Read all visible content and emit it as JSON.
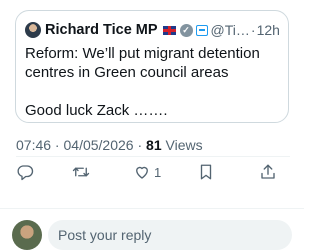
{
  "quote": {
    "author_name": "Richard Tice MP",
    "handle": "@Ti…",
    "separator": "·",
    "time": "12h",
    "text_line1": "Reform: We’ll put migrant detention centres in Green council areas",
    "text_line2": "Good luck Zack ……."
  },
  "meta": {
    "time": "07:46",
    "sep1": " · ",
    "date": "04/05/2026",
    "sep2": " · ",
    "views_count": "81",
    "views_label": " Views"
  },
  "actions": {
    "like_count": "1"
  },
  "reply": {
    "placeholder": "Post your reply"
  },
  "colors": {
    "text_primary": "#0f1419",
    "text_secondary": "#536471",
    "border": "#cfd9de",
    "accent": "#1d9bf0"
  },
  "icons": [
    "reply-icon",
    "retweet-icon",
    "heart-icon",
    "bookmark-icon",
    "share-icon",
    "verified-icon",
    "affiliate-icon",
    "flag-icon"
  ]
}
